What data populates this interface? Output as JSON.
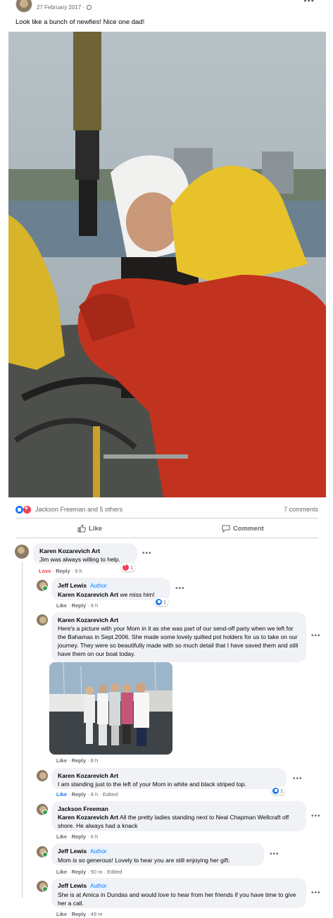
{
  "post": {
    "date": "27 February 2017 ·",
    "text": "Look like a bunch of newfies!  Nice one dad!"
  },
  "reactions": {
    "reactors": "Jackson Freeman and 5 others",
    "comment_count": "7 comments"
  },
  "actions": {
    "like_label": "Like",
    "comment_label": "Comment"
  },
  "comments": [
    {
      "name": "Karen Kozarevich Art",
      "text": "Jim was always willing to help.",
      "meta_reaction": "Love",
      "meta_reply": "Reply",
      "meta_time": "9 h",
      "reaction_count": "1"
    },
    {
      "name": "Jeff Lewis",
      "badge": "Author",
      "mention": "Karen Kozarevich Art",
      "text": " we miss him!",
      "meta_like": "Like",
      "meta_reply": "Reply",
      "meta_time": "9 h",
      "reaction_count": "1"
    },
    {
      "name": "Karen Kozarevich Art",
      "text": "Here's a picture with your Mom in it as she was part of our send-off party when we left for the Bahamas in Sept.2006. She made some lovely quilted pot holders for us to take on our journey. They were so beautifully made with so much detail that I have saved them and still have them on our boat today.",
      "meta_like": "Like",
      "meta_reply": "Reply",
      "meta_time": "8 h"
    },
    {
      "name": "Karen Kozarevich Art",
      "text": "I am standing just to the left of your Mom in white and black striped top.",
      "meta_like": "Like",
      "meta_reply": "Reply",
      "meta_time": "8 h · Edited",
      "reaction_count": "1"
    },
    {
      "name": "Jackson Freeman",
      "mention": "Karen Kozarevich Art",
      "text": " All the pretty ladies standing next to Neal Chapman Wellcraft off shore. He always had a knack",
      "meta_like": "Like",
      "meta_reply": "Reply",
      "meta_time": "6 h"
    },
    {
      "name": "Jeff Lewis",
      "badge": "Author",
      "text": "Mom is so generous! Lovely to hear you are still enjoying her gift.",
      "meta_like": "Like",
      "meta_reply": "Reply",
      "meta_time": "50 m · Edited"
    },
    {
      "name": "Jeff Lewis",
      "badge": "Author",
      "text": "She is at Amica in Dundas and would love to hear from her friends if you have time to give her a call.",
      "meta_like": "Like",
      "meta_reply": "Reply",
      "meta_time": "49 m"
    }
  ],
  "icons": {
    "like_react": "like-reaction-icon",
    "love_react": "love-reaction-icon",
    "more": "more-options-icon",
    "globe": "globe-icon",
    "thumb": "thumbs-up-icon",
    "comment": "comment-bubble-icon"
  },
  "colors": {
    "accent": "#1877f2",
    "love": "#f33e58",
    "bubble": "#f0f2f5",
    "muted": "#65676b",
    "online": "#31a24c"
  }
}
